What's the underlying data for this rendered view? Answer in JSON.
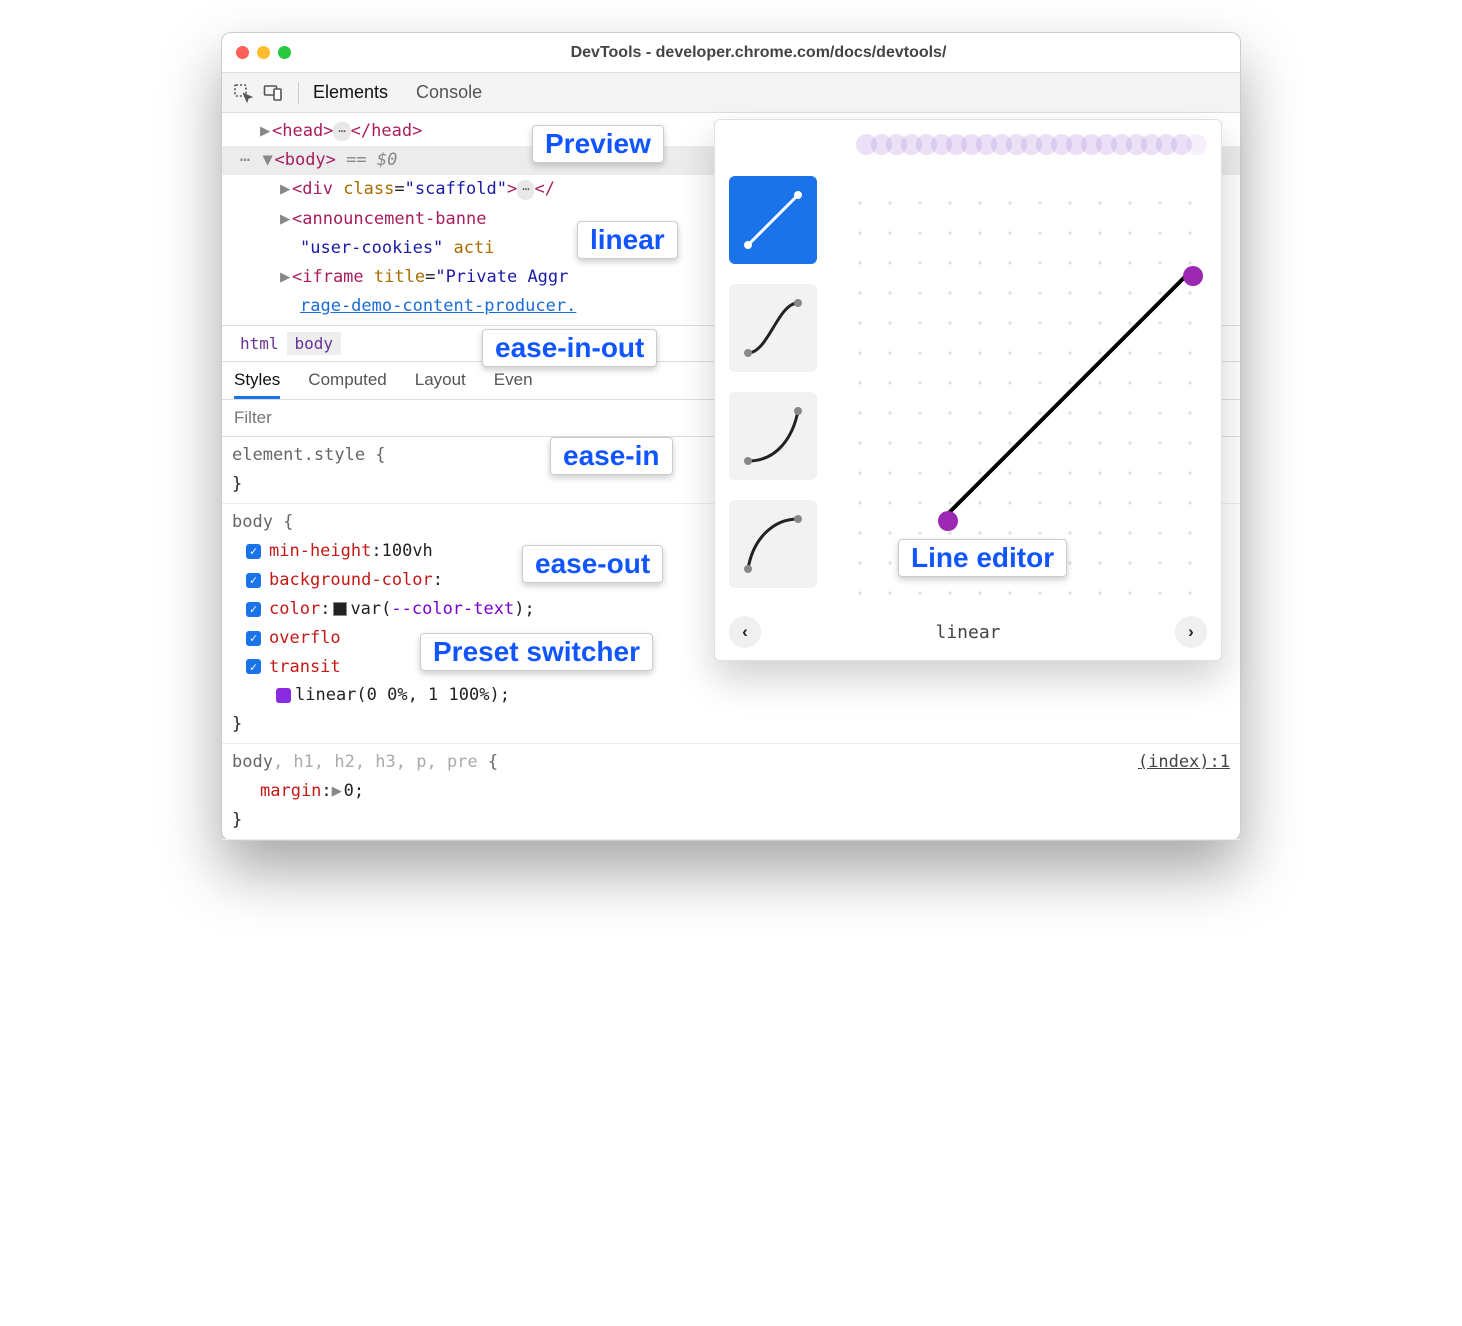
{
  "window": {
    "title": "DevTools - developer.chrome.com/docs/devtools/"
  },
  "toolbar": {
    "tab_elements": "Elements",
    "tab_console": "Console"
  },
  "dom": {
    "head_open": "<head>",
    "head_close": "</head>",
    "body_open": "<body>",
    "eq": "== ",
    "dollar": "$0",
    "div_open": "<div ",
    "class_attr": "class",
    "eq2": "=",
    "scaffold_val": "\"scaffold\"",
    "div_close": "</",
    "ann_open": "<announcement-banne",
    "cookies_val": "\"user-cookies\"",
    "active_attr": " acti",
    "iframe_open": "<iframe ",
    "title_attr": "title",
    "iframe_title_val": "\"Private Aggr",
    "iframe_link": "rage-demo-content-producer."
  },
  "breadcrumb": {
    "a": "html",
    "b": "body"
  },
  "subtabs": {
    "styles": "Styles",
    "computed": "Computed",
    "layout": "Layout",
    "event": "Even"
  },
  "filter_placeholder": "Filter",
  "styles": {
    "inline": "element.style {",
    "body_sel": "body {",
    "min_height_name": "min-height",
    "min_height_val": "100vh",
    "bg_name": "background-color",
    "color_name": "color",
    "color_val_prefix": "var(",
    "color_var": "--color-text",
    "close_paren": ");",
    "overflow_name": "overflo",
    "transition_name": "transit",
    "linear_val": "linear(0 0%, 1 100%);",
    "close_brace": "}",
    "rule2_sel": "body, h1, h2, h3, p, pre {",
    "rule2_src": "(index):1",
    "margin_name": "margin",
    "margin_val": "0"
  },
  "easing": {
    "presets": [
      "linear",
      "ease-in-out",
      "ease-in",
      "ease-out"
    ],
    "current": "linear"
  },
  "callouts": {
    "preview": "Preview",
    "linear": "linear",
    "ease_in_out": "ease-in-out",
    "ease_in": "ease-in",
    "ease_out": "ease-out",
    "preset_switcher": "Preset switcher",
    "line_editor": "Line editor"
  }
}
